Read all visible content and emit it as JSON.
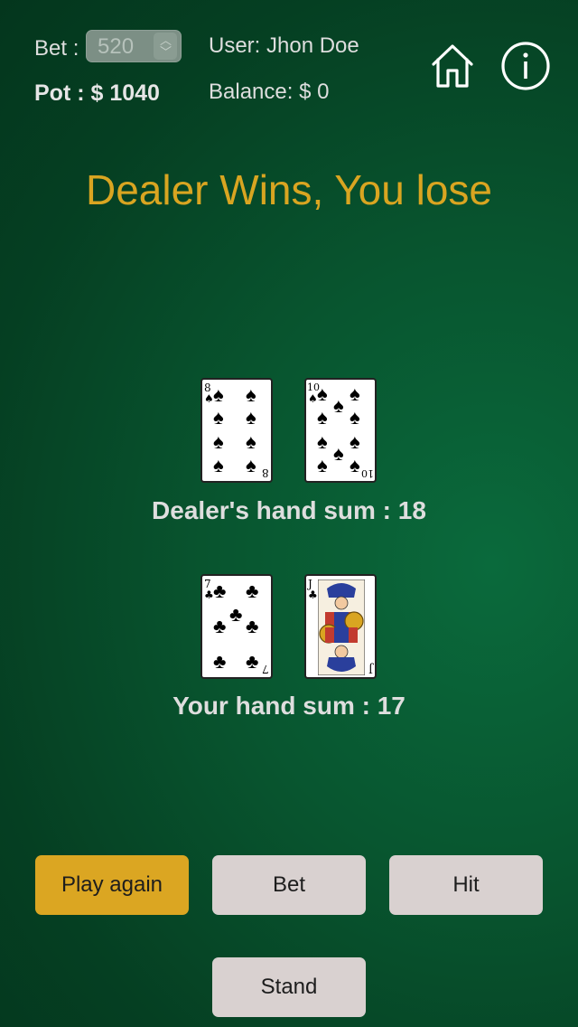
{
  "header": {
    "bet_label": "Bet :",
    "bet_value": "520",
    "pot_text": "Pot : $ 1040",
    "user_text": "User: Jhon Doe",
    "balance_text": "Balance: $ 0",
    "home_icon": "home-icon",
    "info_icon": "info-icon"
  },
  "result_title": "Dealer Wins, You lose",
  "dealer": {
    "cards": [
      {
        "rank": "8",
        "suit": "♠"
      },
      {
        "rank": "10",
        "suit": "♠"
      }
    ],
    "sum_text": "Dealer's hand sum : 18"
  },
  "player": {
    "cards": [
      {
        "rank": "7",
        "suit": "♣"
      },
      {
        "rank": "J",
        "suit": "♣"
      }
    ],
    "sum_text": "Your hand sum : 17"
  },
  "buttons": {
    "play_again": "Play again",
    "bet": "Bet",
    "hit": "Hit",
    "stand": "Stand"
  },
  "colors": {
    "accent": "#d9a521",
    "primary_button": "#dba622",
    "secondary_button": "#d9d1d0"
  }
}
